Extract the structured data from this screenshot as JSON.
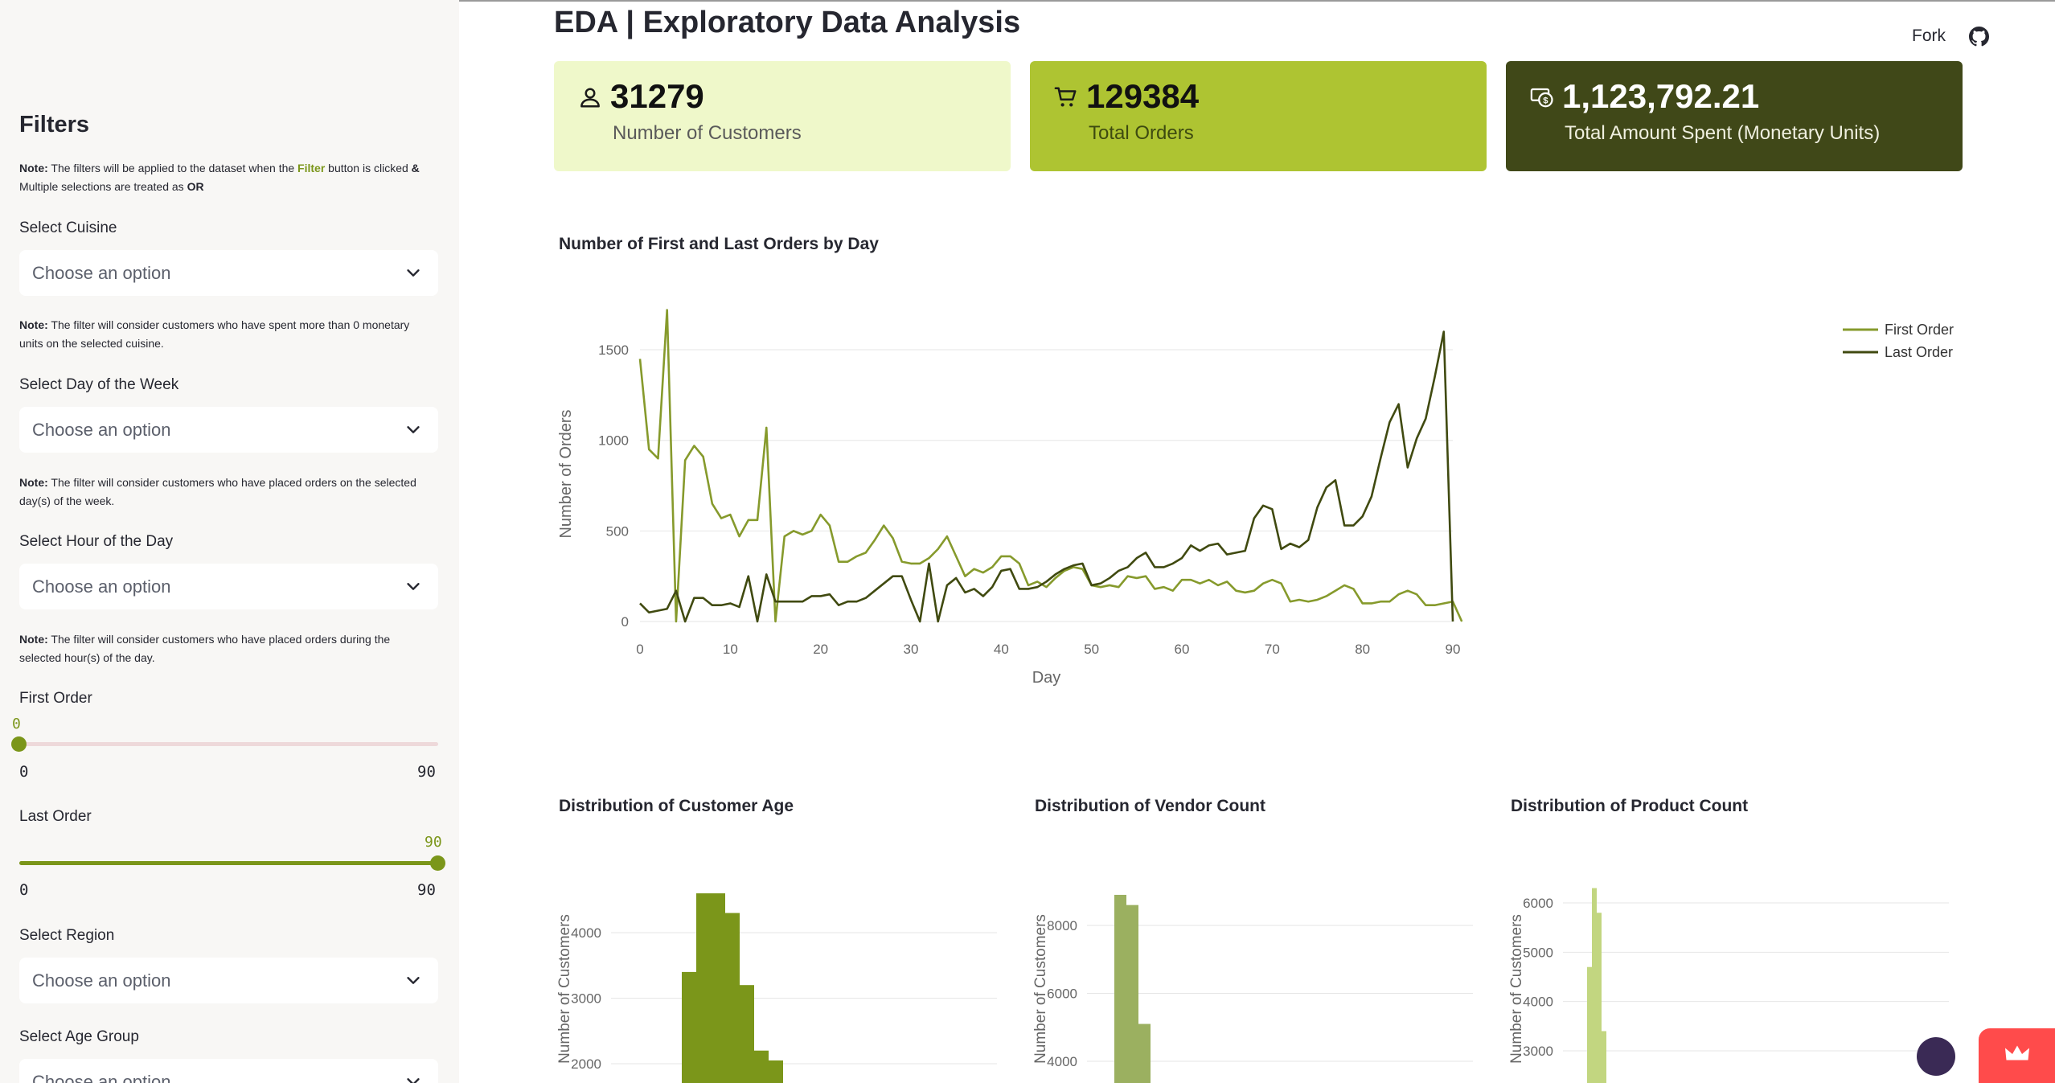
{
  "colors": {
    "accent": "#7b961a",
    "card1": "#eff8ca",
    "card2": "#aec432",
    "card3": "#404818",
    "first_order": "#869a2c",
    "last_order": "#404a10"
  },
  "sidebar": {
    "title": "Filters",
    "note_prefix": "Note:",
    "note_main_1": " The filters will be applied to the dataset when the ",
    "note_main_hl": "Filter",
    "note_main_2": " button is clicked ",
    "note_main_amp": "&",
    "note_main_3": " Multiple selections are treated as ",
    "note_main_or": "OR",
    "cuisine": {
      "label": "Select Cuisine",
      "placeholder": "Choose an option",
      "note": " The filter will consider customers who have spent more than 0 monetary units on the selected cuisine."
    },
    "day": {
      "label": "Select Day of the Week",
      "placeholder": "Choose an option",
      "note": " The filter will consider customers who have placed orders on the selected day(s) of the week."
    },
    "hour": {
      "label": "Select Hour of the Day",
      "placeholder": "Choose an option",
      "note": " The filter will consider customers who have placed orders during the selected hour(s) of the day."
    },
    "first_order": {
      "label": "First Order",
      "value": "0",
      "min": "0",
      "max": "90",
      "fraction": 0.0
    },
    "last_order": {
      "label": "Last Order",
      "value": "90",
      "min": "0",
      "max": "90",
      "fraction": 1.0
    },
    "region": {
      "label": "Select Region",
      "placeholder": "Choose an option"
    },
    "age_group": {
      "label": "Select Age Group",
      "placeholder": "Choose an option"
    }
  },
  "header": {
    "title": "EDA | Exploratory Data Analysis",
    "fork": "Fork"
  },
  "cards": [
    {
      "value": "31279",
      "caption": "Number of Customers",
      "icon": "person-icon"
    },
    {
      "value": "129384",
      "caption": "Total Orders",
      "icon": "cart-icon"
    },
    {
      "value": "1,123,792.21",
      "caption": "Total Amount Spent (Monetary Units)",
      "icon": "money-icon"
    }
  ],
  "chart_data": [
    {
      "type": "line",
      "title": "Number of First and Last Orders by Day",
      "xlabel": "Day",
      "ylabel": "Number of Orders",
      "xlim": [
        0,
        90
      ],
      "ylim": [
        0,
        1700
      ],
      "xticks": [
        0,
        10,
        20,
        30,
        40,
        50,
        60,
        70,
        80,
        90
      ],
      "yticks": [
        0,
        500,
        1000,
        1500
      ],
      "legend": "top-right",
      "grid": true,
      "series": [
        {
          "name": "First Order",
          "color": "#869a2c",
          "values": [
            1450,
            950,
            900,
            1720,
            0,
            890,
            970,
            910,
            650,
            570,
            590,
            470,
            560,
            560,
            1070,
            0,
            470,
            500,
            480,
            500,
            590,
            530,
            330,
            330,
            360,
            380,
            450,
            530,
            460,
            330,
            320,
            320,
            350,
            400,
            470,
            360,
            250,
            290,
            270,
            300,
            360,
            360,
            320,
            200,
            220,
            190,
            240,
            280,
            300,
            290,
            200,
            190,
            200,
            190,
            250,
            240,
            250,
            180,
            190,
            170,
            230,
            230,
            210,
            230,
            200,
            220,
            170,
            160,
            170,
            210,
            230,
            210,
            110,
            120,
            110,
            120,
            140,
            170,
            200,
            180,
            100,
            100,
            110,
            110,
            150,
            170,
            150,
            90,
            90,
            100,
            110,
            0
          ]
        },
        {
          "name": "Last Order",
          "color": "#404a10",
          "values": [
            100,
            50,
            60,
            70,
            170,
            0,
            130,
            130,
            90,
            90,
            100,
            80,
            250,
            0,
            260,
            110,
            110,
            110,
            110,
            140,
            140,
            150,
            90,
            110,
            110,
            130,
            170,
            210,
            250,
            250,
            120,
            0,
            320,
            0,
            200,
            240,
            160,
            180,
            140,
            190,
            280,
            290,
            180,
            180,
            190,
            220,
            260,
            290,
            310,
            320,
            200,
            210,
            240,
            280,
            300,
            350,
            380,
            300,
            300,
            320,
            350,
            420,
            390,
            420,
            430,
            370,
            380,
            390,
            570,
            640,
            620,
            400,
            430,
            410,
            450,
            630,
            740,
            780,
            530,
            530,
            580,
            690,
            900,
            1100,
            1200,
            850,
            1010,
            1120,
            1350,
            1600,
            0
          ]
        }
      ]
    },
    {
      "type": "bar",
      "title": "Distribution of Customer Age",
      "ylabel": "Number of Customers",
      "yticks": [
        2000,
        3000,
        4000
      ],
      "color": "#7b961a",
      "values": [
        3400,
        4600,
        4600,
        4300,
        3200,
        2200,
        2050
      ],
      "series_note": "histogram"
    },
    {
      "type": "bar",
      "title": "Distribution of Vendor Count",
      "ylabel": "Number of Customers",
      "yticks": [
        4000,
        6000,
        8000
      ],
      "color": "#9bb060",
      "values": [
        8900,
        8600,
        5100
      ],
      "series_note": "histogram"
    },
    {
      "type": "bar",
      "title": "Distribution of Product Count",
      "ylabel": "Number of Customers",
      "yticks": [
        3000,
        4000,
        5000,
        6000
      ],
      "color": "#c2d680",
      "values": [
        4700,
        6300,
        5800,
        3400
      ],
      "series_note": "histogram"
    }
  ]
}
